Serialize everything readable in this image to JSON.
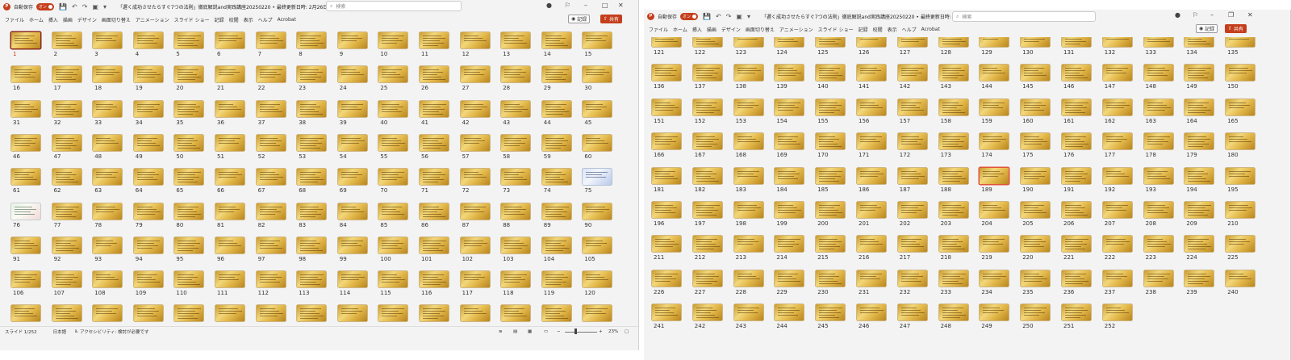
{
  "app": {
    "autosave_label": "自動保存",
    "autosave_state": "オン",
    "doc_title": "「遅く成功させたらすぐ7つの法則」徹底解説and実践講座20250220 • 最終更新日時: 2月26日",
    "search_placeholder": "検索"
  },
  "ribbon_tabs": [
    "ファイル",
    "ホーム",
    "挿入",
    "描画",
    "デザイン",
    "画面切り替え",
    "アニメーション",
    "スライド ショー",
    "記録",
    "校閲",
    "表示",
    "ヘルプ",
    "Acrobat"
  ],
  "record_label": "記録",
  "share_label": "共有",
  "status": {
    "slide_counter": "スライド 1/252",
    "language": "日本語",
    "accessibility": "アクセシビリティ: 検討が必要です",
    "zoom": "23%"
  },
  "windowA": {
    "first_slide": 1,
    "last_slide": 135,
    "selected_slide": 1
  },
  "windowB": {
    "first_slide": 121,
    "last_slide": 252,
    "selected_slide": 189
  },
  "colors": {
    "accent": "#c43e1c",
    "slide_gold": "#e3b84a"
  }
}
